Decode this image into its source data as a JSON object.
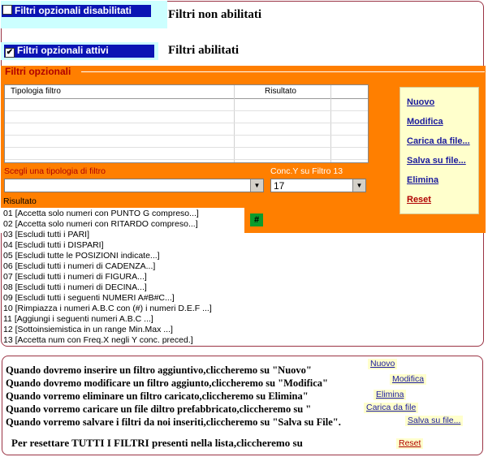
{
  "top": {
    "disabled_checkbox_label": "Filtri opzionali disabilitati",
    "disabled_caption": "Filtri non abilitati",
    "enabled_checkbox_label": "Filtri opzionali attivi",
    "enabled_caption": "Filtri abilitati",
    "enabled_checkmark": "✔"
  },
  "panel": {
    "title": "Filtri opzionali",
    "grid": {
      "columns": [
        "Tipologia filtro",
        "Risultato"
      ]
    },
    "filter_type_label": "Scegli una tipologia di filtro",
    "filter_type_value": "",
    "conc_label": "Conc.Y su Filtro 13",
    "conc_value": "17",
    "hash_button": "#",
    "result_label": "Risultato",
    "side_buttons": [
      "Nuovo",
      "Modifica",
      "Carica da file...",
      "Salva su file...",
      "Elimina",
      "Reset"
    ],
    "results": [
      "01 [Accetta solo numeri con PUNTO G compreso...]",
      "02 [Accetta solo numeri con RITARDO compreso...]",
      "03 [Escludi tutti i PARI]",
      "04 [Escludi tutti i DISPARI]",
      "05 [Escludi tutte le POSIZIONI indicate...]",
      "06 [Escludi tutti i numeri di CADENZA...]",
      "07 [Escludi tutti i numeri di FIGURA...]",
      "08 [Escludi tutti i numeri di DECINA...]",
      "09 [Escludi tutti i seguenti NUMERI A#B#C...]",
      "10 [Rimpiazza i numeri A.B.C con (#) i numeri D.E.F ...]",
      "11 [Aggiungi i seguenti numeri A.B.C ...]",
      "12 [Sottoinsiemistica in un range Min.Max ...]",
      "13 [Accetta num con Freq.X negli Y conc. preced.]"
    ]
  },
  "help": {
    "lines": [
      "Quando dovremo inserire un filtro aggiuntivo,cliccheremo su \"Nuovo\"",
      "Quando dovremo modificare un filtro aggiunto,cliccheremo su \"Modifica\"",
      "Quando vorremo eliminare un filtro caricato,cliccheremo su Elimina\"",
      "Quando vorremo caricare un file diltro prefabbricato,cliccheremo su \"",
      "Quando vorremo salvare i filtri da noi inseriti,cliccheremo su \"Salva su File\"."
    ],
    "reset_line": "Per resettare TUTTI I FILTRI presenti nella lista,cliccheremo su",
    "buttons": [
      "Nuovo",
      "Modifica",
      "Elimina",
      "Carica da file",
      "Salva su file...",
      "Reset"
    ]
  },
  "colors": {
    "accent_orange": "#ff7f00",
    "checkbox_blue": "#0a14b4",
    "link_blue": "#1a1a9c",
    "frame_red": "#9a3344"
  }
}
